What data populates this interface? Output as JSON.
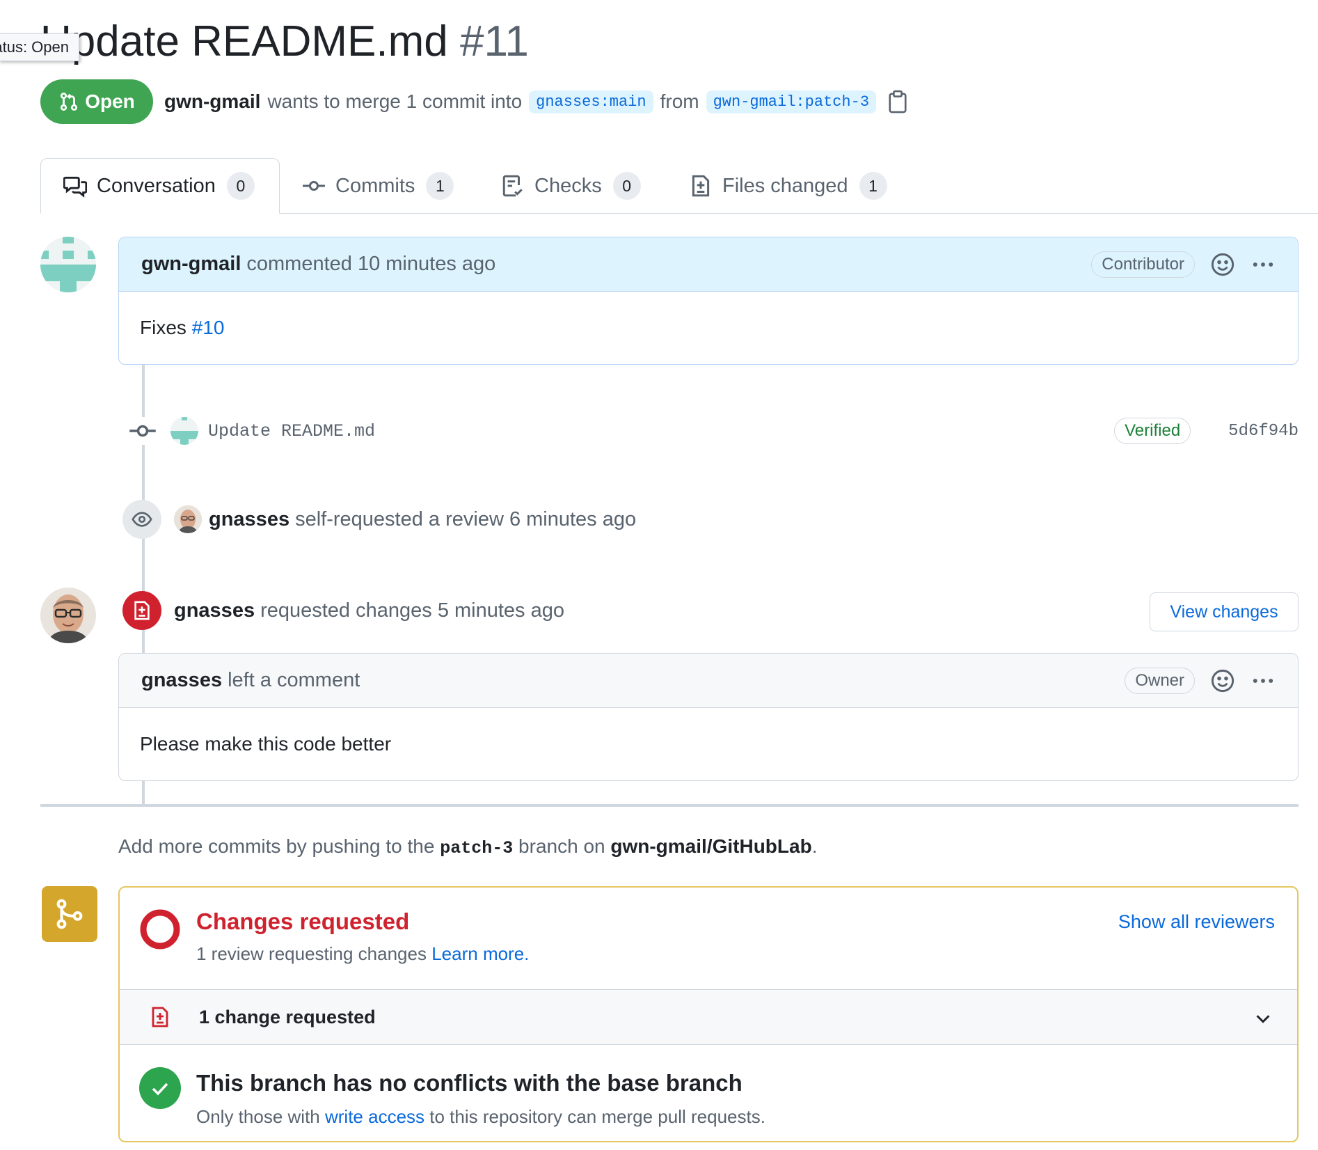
{
  "tooltip": "Status: Open",
  "title": {
    "text": "Update README.md",
    "number": "#11"
  },
  "state": {
    "label": "Open",
    "color": "#3fa552"
  },
  "meta": {
    "author": "gwn-gmail",
    "wants_text": "wants to merge 1 commit into",
    "base_branch": "gnasses:main",
    "from_text": "from",
    "head_branch": "gwn-gmail:patch-3"
  },
  "tabs": [
    {
      "label": "Conversation",
      "count": "0",
      "icon": "comment-discussion-icon"
    },
    {
      "label": "Commits",
      "count": "1",
      "icon": "git-commit-icon"
    },
    {
      "label": "Checks",
      "count": "0",
      "icon": "checklist-icon"
    },
    {
      "label": "Files changed",
      "count": "1",
      "icon": "file-diff-icon"
    }
  ],
  "first_comment": {
    "author": "gwn-gmail",
    "action": "commented 10 minutes ago",
    "role": "Contributor",
    "body_prefix": "Fixes ",
    "body_link": "#10"
  },
  "commit": {
    "message": "Update README.md",
    "verified": "Verified",
    "sha": "5d6f94b"
  },
  "review_request": {
    "author": "gnasses",
    "action": "self-requested a review 6 minutes ago"
  },
  "review": {
    "author": "gnasses",
    "action": "requested changes 5 minutes ago",
    "view_changes": "View changes",
    "comment_author": "gnasses",
    "comment_action": "left a comment",
    "role": "Owner",
    "body": "Please make this code better"
  },
  "push_hint": {
    "prefix": "Add more commits by pushing to the",
    "branch": "patch-3",
    "middle": "branch on",
    "repo": "gwn-gmail/GitHubLab",
    "suffix": "."
  },
  "merge_box": {
    "changes_title": "Changes requested",
    "changes_sub": "1 review requesting changes",
    "learn_more": "Learn more.",
    "show_all": "Show all reviewers",
    "change_count": "1 change requested",
    "conflict_title": "This branch has no conflicts with the base branch",
    "conflict_sub_prefix": "Only those with",
    "write_access": "write access",
    "conflict_sub_suffix": "to this repository can merge pull requests."
  },
  "colors": {
    "accent": "#0969da",
    "danger": "#cf222e",
    "success": "#2da44e",
    "attention": "#d4a72c"
  }
}
